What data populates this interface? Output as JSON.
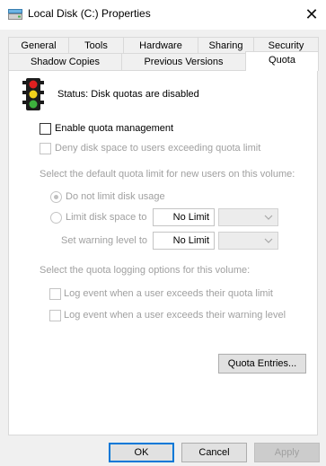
{
  "window": {
    "title": "Local Disk (C:) Properties",
    "close_symbol": "✕"
  },
  "tabs": {
    "row1": [
      "General",
      "Tools",
      "Hardware",
      "Sharing",
      "Security"
    ],
    "row2": [
      "Shadow Copies",
      "Previous Versions",
      "Quota"
    ],
    "active": "Quota"
  },
  "status": {
    "text": "Status:  Disk quotas are disabled",
    "icon": "traffic-light-icon"
  },
  "options": {
    "enable_quota": "Enable quota management",
    "deny_space": "Deny disk space to users exceeding quota limit"
  },
  "default_limit": {
    "heading": "Select the default quota limit for new users on this volume:",
    "no_limit_radio": "Do not limit disk usage",
    "limit_radio": "Limit disk space to",
    "limit_value": "No Limit",
    "warning_label": "Set warning level to",
    "warning_value": "No Limit"
  },
  "logging": {
    "heading": "Select the quota logging options for this volume:",
    "log_limit": "Log event when a user exceeds their quota limit",
    "log_warning": "Log event when a user exceeds their warning level"
  },
  "buttons": {
    "quota_entries": "Quota Entries...",
    "ok": "OK",
    "cancel": "Cancel",
    "apply": "Apply"
  },
  "colors": {
    "accent": "#0078d7",
    "disabled_text": "#a0a0a0"
  }
}
